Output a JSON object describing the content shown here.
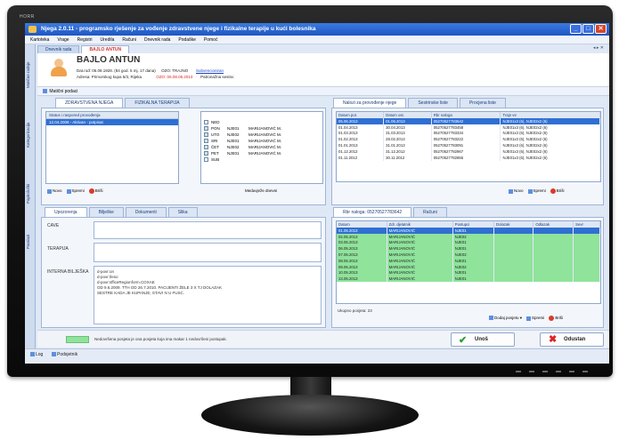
{
  "monitor": {
    "brand": "HORR"
  },
  "window": {
    "title": "Njega 2.0.11 - programsko rješenje za vođenje zdravstvene njege i fizikalne terapije u kući bolesnika",
    "min": "_",
    "max": "□",
    "close": "✕"
  },
  "menu": [
    "Kartoteka",
    "Vrage",
    "Registri",
    "Uredila",
    "Računi",
    "Dnevnik rada",
    "Podaške",
    "Pomoć"
  ],
  "doc_tabs": [
    {
      "label": "Dnevnik rada"
    },
    {
      "label": "BAJLO ANTUN"
    }
  ],
  "doc_tabs_close": "◂ ▸ ✕",
  "sidebar": [
    "Matične radnje",
    "Kategorizacija",
    "Papirološki",
    "Paralazi"
  ],
  "patient": {
    "name": "BAJLO ANTUN",
    "line1_prefix": "Dat.rođ: 06.08.1928. (84 god. 5 mj. 17 dana)",
    "line1_mid": "OZO: TRAJNO",
    "line1_link": "Subvencioniran",
    "line2_prefix": "Adresa: Primorskog kupa 5/3, Rijeka",
    "line2_red": "OZO: 06.08.05.2013",
    "line2_suffix": "Patronažna sestra:"
  },
  "subtoolbar": {
    "label": "Matični podaci"
  },
  "left_tabs": [
    {
      "label": "ZDRAVSTVENA NJEGA"
    },
    {
      "label": "FIZIKALNA TERAPIJA"
    }
  ],
  "status_box": {
    "header": "Status i raspored provođenja",
    "selected": "12.04.2008 - Aktivan - potpisat"
  },
  "days": [
    {
      "day": "NED",
      "checked": false,
      "code": "",
      "name": ""
    },
    {
      "day": "PON",
      "checked": true,
      "code": "NJE01",
      "name": "MARIJANOVIĆ M."
    },
    {
      "day": "UTO",
      "checked": true,
      "code": "NJE02",
      "name": "MARIJANOVIĆ M."
    },
    {
      "day": "SRI",
      "checked": true,
      "code": "NJE01",
      "name": "MARIJANOVIĆ M."
    },
    {
      "day": "ČET",
      "checked": true,
      "code": "NJE02",
      "name": "MARIJANOVIĆ M."
    },
    {
      "day": "PET",
      "checked": true,
      "code": "NJE01",
      "name": "MARIJANOVIĆ M."
    },
    {
      "day": "SUB",
      "checked": false,
      "code": "",
      "name": ""
    }
  ],
  "left_buttons": {
    "new": "Novo",
    "save": "Spremi",
    "delete": "Briši",
    "extra": "Meduvježe dnevni"
  },
  "note_tabs": [
    {
      "label": "Upozorenja"
    },
    {
      "label": "Bilješke"
    },
    {
      "label": "Dokumenti"
    },
    {
      "label": "Slika"
    }
  ],
  "notes": {
    "cave_label": "CAVE",
    "terapija_label": "TERAPIJA",
    "interna_label": "INTERNA BILJEŠKA",
    "lines": [
      "d-povr:on",
      "d-povr:/leso",
      "d-povr:sfficeRegionform.COXAE",
      "OD 9.6.2009. TTH  OD 26.7.2010. PACIJENTI ŽELE 3 X TJ DOLAZAK",
      "SESTRE  KADA JE KUPANJE, STAVI N U FUSC."
    ]
  },
  "right_top_tabs": [
    {
      "label": "Nalozi za provođenje njege"
    },
    {
      "label": "Sestrinske liste"
    },
    {
      "label": "Procjena liste"
    }
  ],
  "orders": {
    "columns": [
      "Datum pot.",
      "Datum ost.",
      "Rbr naloga",
      "Trajn ve"
    ],
    "rows": [
      [
        "05.06.2013",
        "01.06.2013",
        "05270527783642",
        "NJE01x3 (6), NJE02x2 (6)"
      ],
      [
        "01.04.2013",
        "30.04.2013",
        "05270527783458",
        "NJE01x3 (6), NJE02x2 (6)"
      ],
      [
        "01.03.2013",
        "31.03.2013",
        "05270527783334",
        "NJE01x3 (6), NJE02x2 (6)"
      ],
      [
        "01.02.2013",
        "28.02.2013",
        "05270527783222",
        "NJE01x3 (6), NJE02x2 (6)"
      ],
      [
        "01.01.2013",
        "31.01.2013",
        "05270527783091",
        "NJE01x3 (6), NJE02x2 (6)"
      ],
      [
        "01.12.2012",
        "31.12.2012",
        "05270527782967",
        "NJE01x3 (6), NJE02x2 (6)"
      ],
      [
        "01.11.2012",
        "30.11.2012",
        "05270527782855",
        "NJE01x3 (6), NJE02x2 (6)"
      ]
    ],
    "selected_index": 0
  },
  "right_top_buttons": {
    "new": "Novo",
    "save": "Spremi",
    "delete": "Briši"
  },
  "right_bottom_tabs": [
    {
      "label": "Rbr naloga: 05270527783642"
    },
    {
      "label": "Računi"
    }
  ],
  "visits": {
    "columns": [
      "Datum",
      "Zdr. djelatnik",
      "Postupci",
      "Dolazak",
      "Odlazak",
      "Sevr"
    ],
    "rows": [
      [
        "01.05.2013",
        "MARIJANOVIĆ",
        "NJE01"
      ],
      [
        "02.05.2013",
        "MARIJANOVIĆ",
        "NJE02"
      ],
      [
        "03.05.2013",
        "MARIJANOVIĆ",
        "NJE01"
      ],
      [
        "06.05.2013",
        "MARIJANOVIĆ",
        "NJE01"
      ],
      [
        "07.05.2013",
        "MARIJANOVIĆ",
        "NJE02"
      ],
      [
        "08.05.2013",
        "MARIJANOVIĆ",
        "NJE01"
      ],
      [
        "09.05.2013",
        "MARIJANOVIĆ",
        "NJE02"
      ],
      [
        "10.05.2013",
        "MARIJANOVIĆ",
        "NJE01"
      ],
      [
        "13.05.2013",
        "MARIJANOVIĆ",
        "NJE01"
      ]
    ],
    "selected_index": 0,
    "footer": "Ukupno posjeta: 23"
  },
  "right_bottom_buttons": {
    "add": "Dodaj posjetu",
    "save": "Spremi",
    "delete": "Briši"
  },
  "statusbar": {
    "legend": "Nedovršena posjeta je ona posjeta koja ima makar 1 nedovršeni postupak.",
    "ok": "Unoš",
    "cancel": "Odustan"
  },
  "taskbar": {
    "item1": "Log",
    "item2": "Podsjetnik"
  },
  "colors": {
    "title_bar": "#1f56c4",
    "selection": "#2f6fd3",
    "visit_row": "#8fe39b"
  }
}
